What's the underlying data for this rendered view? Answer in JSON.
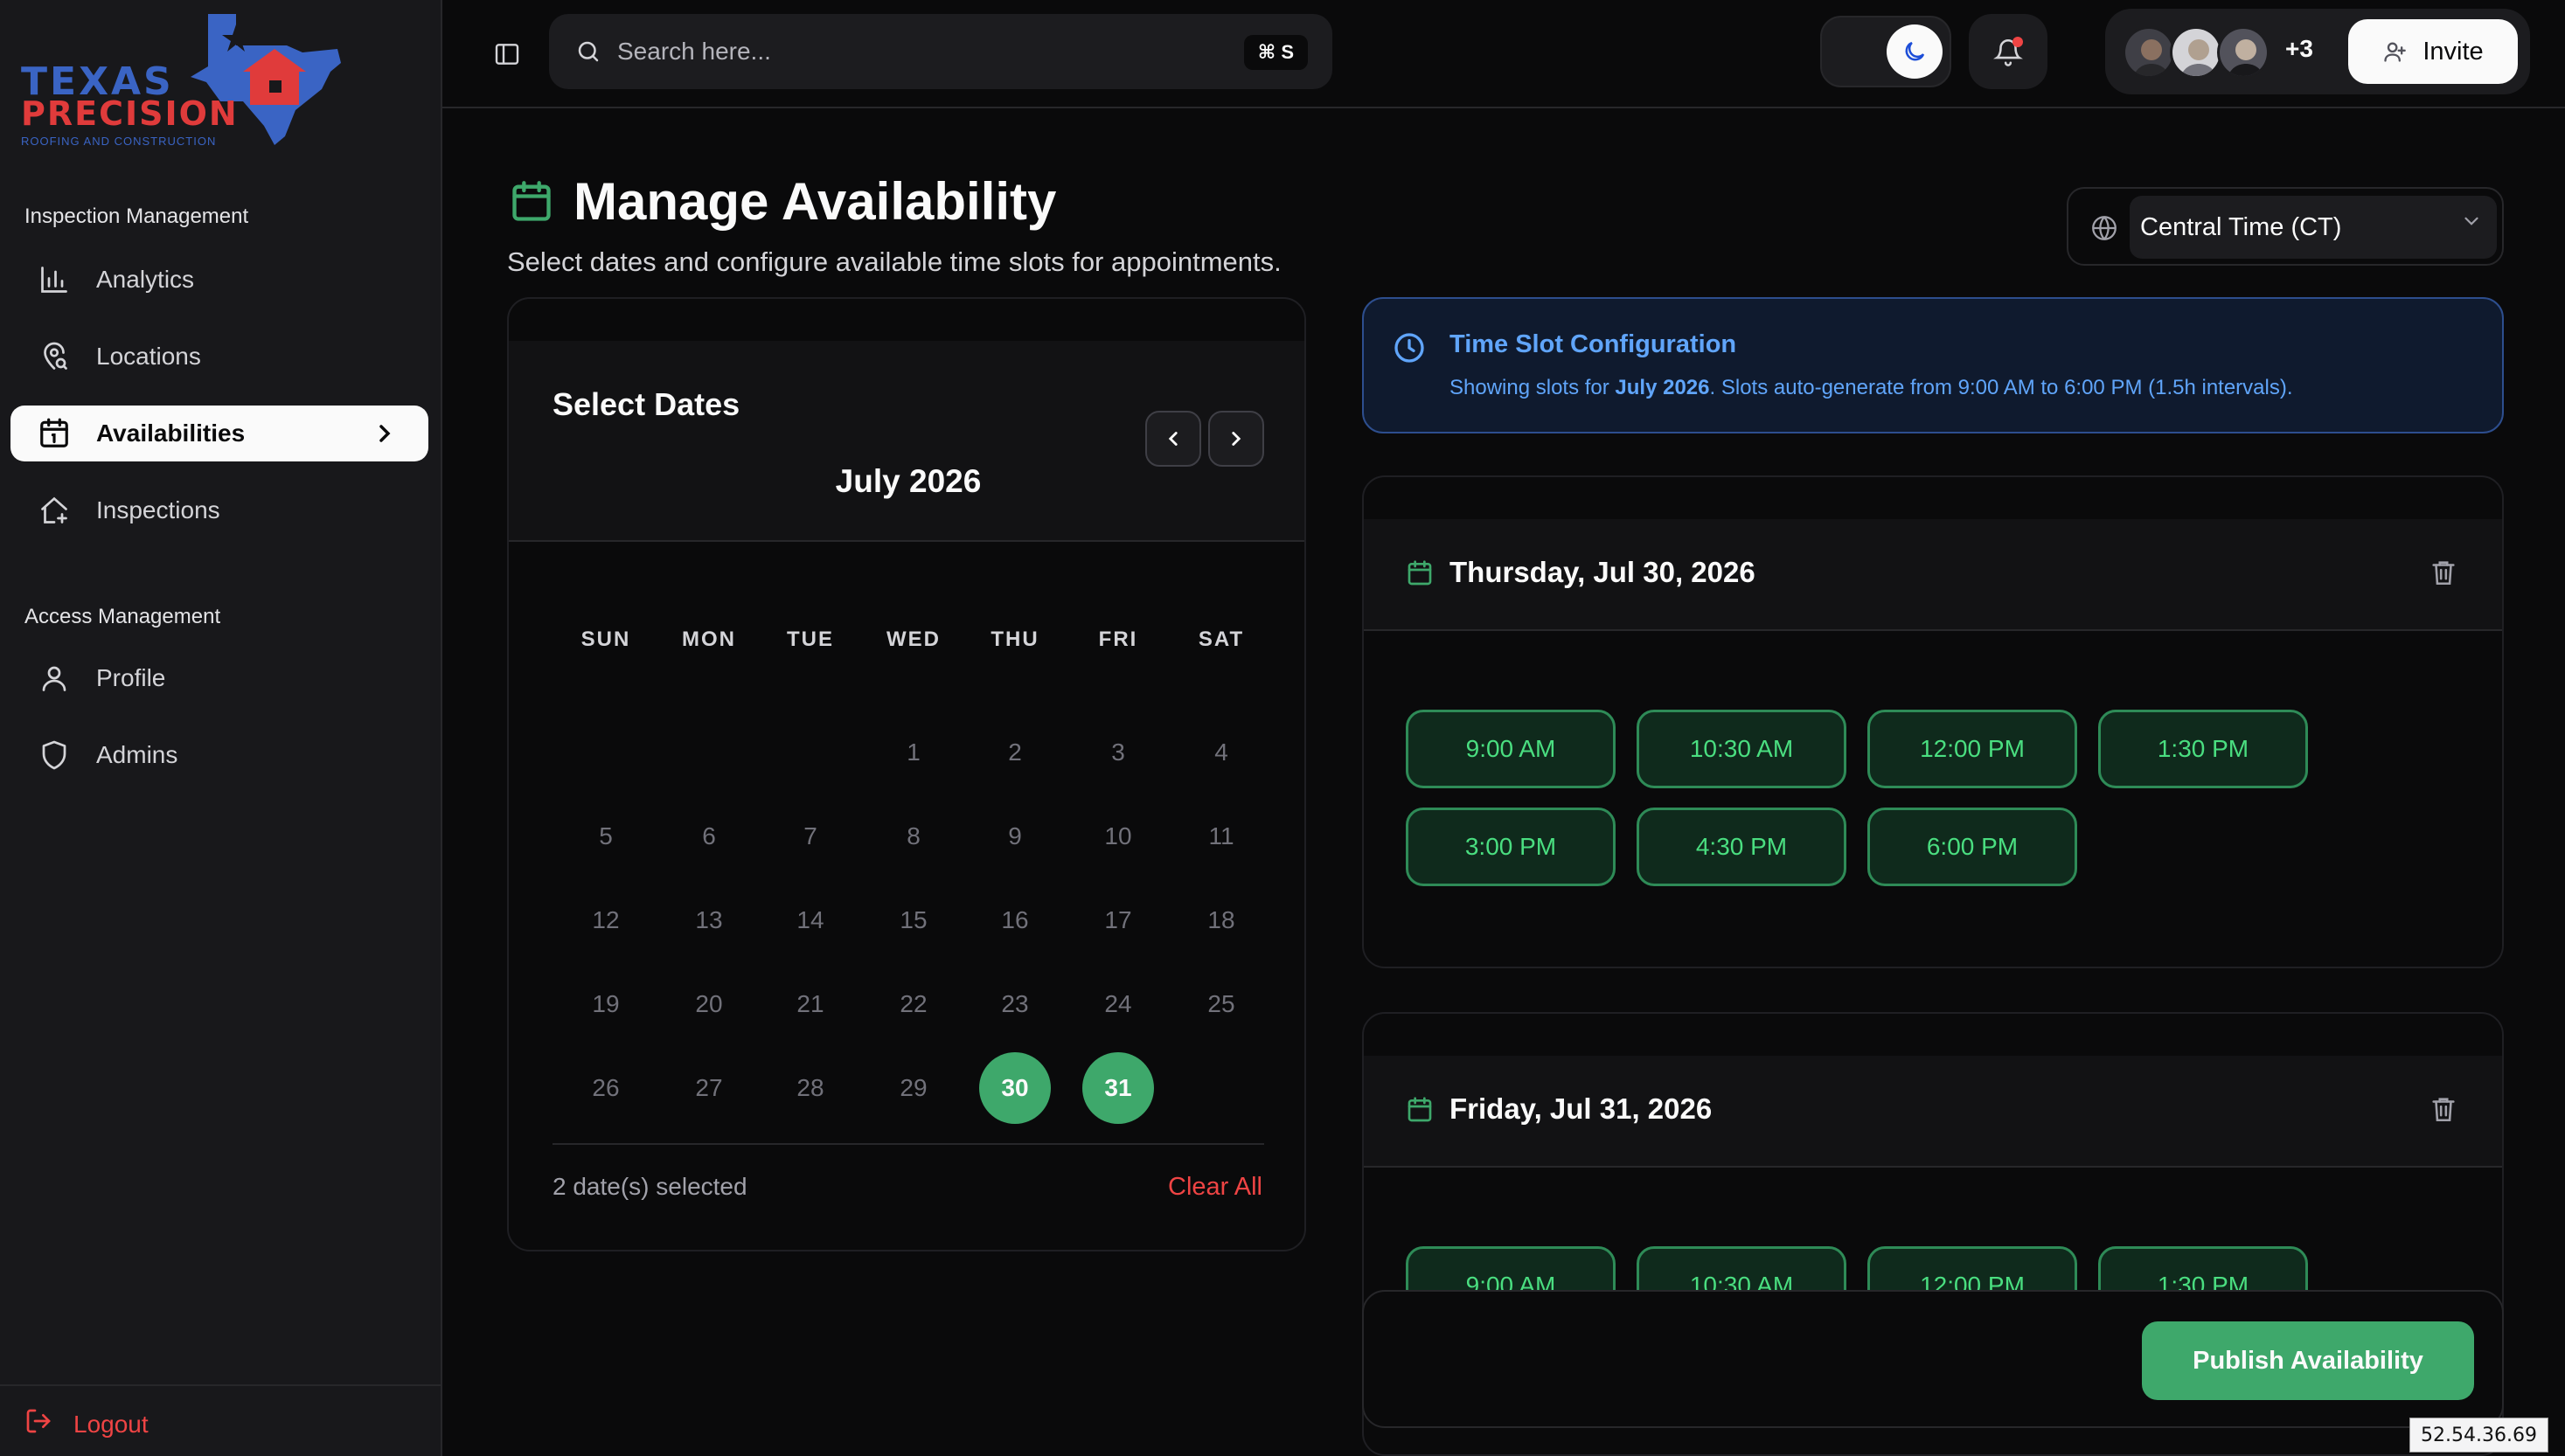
{
  "brand": {
    "line1": "TEXAS",
    "line2": "PRECISION",
    "tagline": "ROOFING AND CONSTRUCTION",
    "colors": {
      "blue": "#3a64c4",
      "red": "#e03b3b"
    }
  },
  "sidebar": {
    "sections": [
      {
        "label": "Inspection Management",
        "items": [
          {
            "label": "Analytics",
            "icon": "bar-chart-icon",
            "active": false
          },
          {
            "label": "Locations",
            "icon": "map-pin-icon",
            "active": false
          },
          {
            "label": "Availabilities",
            "icon": "calendar-icon",
            "active": true
          },
          {
            "label": "Inspections",
            "icon": "house-plus-icon",
            "active": false
          }
        ]
      },
      {
        "label": "Access Management",
        "items": [
          {
            "label": "Profile",
            "icon": "user-icon",
            "active": false
          },
          {
            "label": "Admins",
            "icon": "shield-icon",
            "active": false
          }
        ]
      }
    ],
    "logout": "Logout"
  },
  "header": {
    "search_placeholder": "Search here...",
    "search_shortcut": "⌘ S",
    "team_more": "+3",
    "invite_label": "Invite"
  },
  "page": {
    "title": "Manage Availability",
    "subtitle": "Select dates and configure available time slots for appointments.",
    "timezone": "Central Time (CT)"
  },
  "calendar": {
    "label": "Select Dates",
    "month": "July 2026",
    "weekdays": [
      "SUN",
      "MON",
      "TUE",
      "WED",
      "THU",
      "FRI",
      "SAT"
    ],
    "first_weekday_index": 3,
    "days_in_month": 31,
    "selected_days": [
      30,
      31
    ],
    "selected_count_text": "2 date(s) selected",
    "clear_all": "Clear All"
  },
  "info": {
    "title": "Time Slot Configuration",
    "prefix": "Showing slots for ",
    "month_bold": "July 2026",
    "suffix": ". Slots auto-generate from 9:00 AM to 6:00 PM (1.5h intervals)."
  },
  "date_cards": [
    {
      "date": "Thursday, Jul 30, 2026",
      "slots": [
        "9:00 AM",
        "10:30 AM",
        "12:00 PM",
        "1:30 PM",
        "3:00 PM",
        "4:30 PM",
        "6:00 PM"
      ]
    },
    {
      "date": "Friday, Jul 31, 2026",
      "slots": [
        "9:00 AM",
        "10:30 AM",
        "12:00 PM",
        "1:30 PM"
      ]
    }
  ],
  "publish_label": "Publish Availability",
  "ip_address": "52.54.36.69",
  "colors": {
    "accent_green": "#3ea86b",
    "slot_text": "#4ade80",
    "danger": "#ef4444",
    "info_blue": "#60a5fa"
  }
}
